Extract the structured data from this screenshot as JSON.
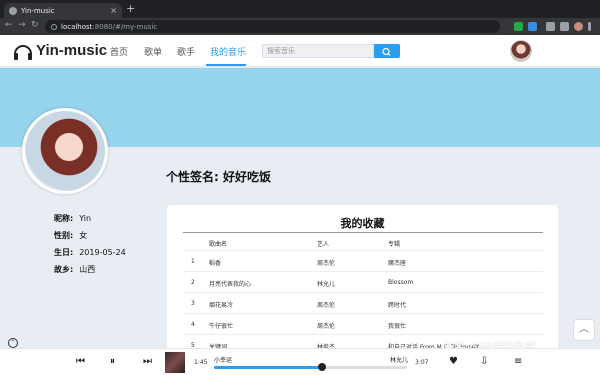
{
  "browser": {
    "tab_title": "Yin-music",
    "tab_close": "×",
    "new_tab": "+",
    "url_host": "localhost",
    "url_path": ":8080/#/my-music"
  },
  "header": {
    "brand": "Yin-music",
    "nav": [
      "首页",
      "歌单",
      "歌手",
      "我的音乐"
    ],
    "active_nav": "我的音乐",
    "search_placeholder": "搜索音乐"
  },
  "profile": {
    "signature_label": "个性签名: ",
    "signature": "好好吃饭",
    "info": [
      {
        "key": "昵称:",
        "value": "Yin"
      },
      {
        "key": "性别:",
        "value": "女"
      },
      {
        "key": "生日:",
        "value": "2019-05-24"
      },
      {
        "key": "故乡:",
        "value": "山西"
      }
    ]
  },
  "collection": {
    "title": "我的收藏",
    "columns": [
      "歌曲名",
      "艺人",
      "专辑"
    ],
    "rows": [
      {
        "index": "1",
        "song": "稻香",
        "artist": "周杰伦",
        "album": "魔杰座"
      },
      {
        "index": "2",
        "song": "月亮代表我的心",
        "artist": "林允儿",
        "album": "Blossom"
      },
      {
        "index": "3",
        "song": "烟花易冷",
        "artist": "周杰伦",
        "album": "跨时代"
      },
      {
        "index": "4",
        "song": "牛仔很忙",
        "artist": "周杰伦",
        "album": "我很忙"
      },
      {
        "index": "5",
        "song": "关键词",
        "artist": "林俊杰",
        "album": "和自己对话 From M.E. To Myself"
      }
    ]
  },
  "player": {
    "current_time": "1:45",
    "total_time": "3:07",
    "song": "小幸运",
    "artist": "林允儿",
    "progress": 0.56
  },
  "watermark": "知乎 @终端研发部",
  "colors": {
    "accent": "#2b9ef0",
    "banner": "#96d3ec",
    "page_bg": "#e8edf3"
  }
}
